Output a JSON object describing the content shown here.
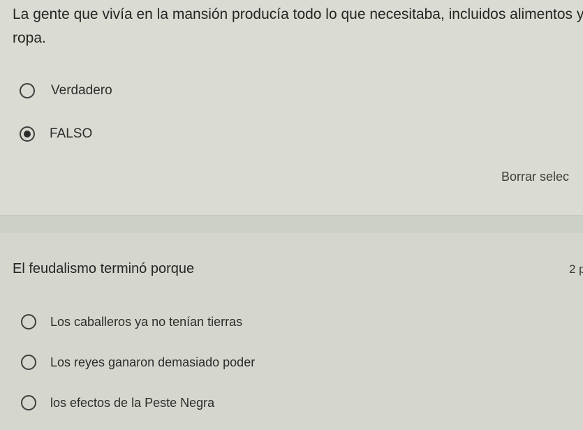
{
  "question_1": {
    "title": "La gente que vivía en la mansión producía todo lo que necesitaba, incluidos alimentos y ropa.",
    "options": [
      {
        "label": "Verdadero",
        "selected": false
      },
      {
        "label": "FALSO",
        "selected": true
      }
    ],
    "clear_label": "Borrar selec"
  },
  "question_2": {
    "title": "El feudalismo terminó porque",
    "points": "2 p",
    "options": [
      {
        "label": "Los caballeros ya no tenían tierras",
        "selected": false
      },
      {
        "label": "Los reyes ganaron demasiado poder",
        "selected": false
      },
      {
        "label": "los efectos de la Peste Negra",
        "selected": false
      }
    ]
  }
}
